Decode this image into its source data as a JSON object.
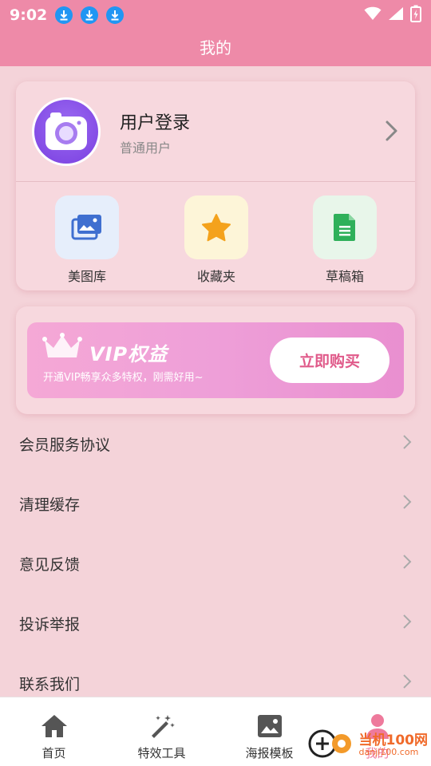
{
  "status": {
    "time": "9:02",
    "download_icons": 3
  },
  "header": {
    "title": "我的"
  },
  "profile": {
    "title": "用户登录",
    "subtitle": "普通用户"
  },
  "quick_actions": [
    {
      "label": "美图库",
      "icon": "gallery-icon",
      "bg": "#e6eefb",
      "color": "#3f6fd0"
    },
    {
      "label": "收藏夹",
      "icon": "star-icon",
      "bg": "#fdf5d8",
      "color": "#f4a21c"
    },
    {
      "label": "草稿箱",
      "icon": "document-icon",
      "bg": "#e8f6ea",
      "color": "#2fb05a"
    }
  ],
  "vip": {
    "title": "VIP权益",
    "subtitle": "开通VIP畅享众多特权，刚需好用~",
    "button": "立即购买"
  },
  "menu": [
    {
      "label": "会员服务协议"
    },
    {
      "label": "清理缓存"
    },
    {
      "label": "意见反馈"
    },
    {
      "label": "投诉举报"
    },
    {
      "label": "联系我们"
    }
  ],
  "tabs": [
    {
      "label": "首页",
      "icon": "home-icon"
    },
    {
      "label": "特效工具",
      "icon": "magic-wand-icon"
    },
    {
      "label": "海报模板",
      "icon": "image-icon"
    },
    {
      "label": "我的",
      "icon": "user-icon",
      "active": true
    }
  ],
  "watermark": {
    "cn": "当机100网",
    "en": "danji100.com"
  },
  "colors": {
    "accent": "#ee8aa8",
    "background": "#f4d3d9",
    "active_tab": "#ee7a9c"
  }
}
